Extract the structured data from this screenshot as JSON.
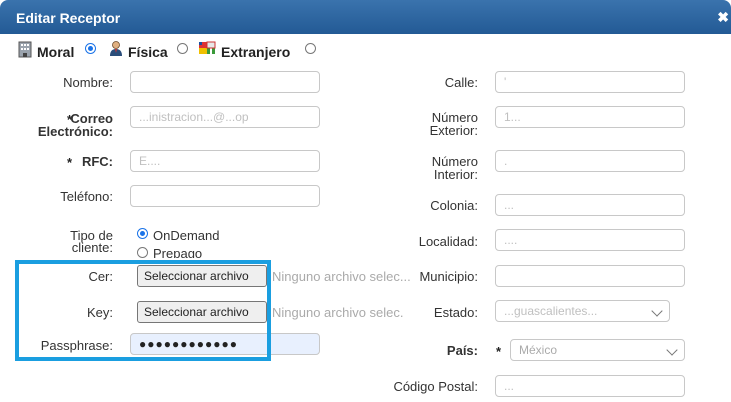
{
  "window": {
    "title": "Editar Receptor",
    "close_glyph": "✖"
  },
  "person_type": {
    "options": [
      {
        "label": "Moral",
        "selected": true,
        "icon": "building-icon"
      },
      {
        "label": "Física",
        "selected": false,
        "icon": "person-icon"
      },
      {
        "label": "Extranjero",
        "selected": false,
        "icon": "flags-icon"
      }
    ]
  },
  "left": {
    "nombre": {
      "label": "Nombre:",
      "value": ""
    },
    "correo": {
      "label_star": "*",
      "label_line1": "Correo",
      "label_line2": "Electrónico:",
      "value": "...inistracion...@...op"
    },
    "rfc": {
      "label_star": "*",
      "label": "RFC:",
      "value": "E...."
    },
    "telefono": {
      "label": "Teléfono:",
      "value": ""
    },
    "tipo_cliente": {
      "label_line1": "Tipo de",
      "label_line2": "cliente:",
      "options": [
        {
          "label": "OnDemand",
          "selected": true
        },
        {
          "label": "Prepago",
          "selected": false
        }
      ]
    },
    "cer": {
      "label": "Cer:",
      "button": "Seleccionar archivo",
      "status": "Ninguno archivo selec..."
    },
    "key": {
      "label": "Key:",
      "button": "Seleccionar archivo",
      "status": "Ninguno archivo selec."
    },
    "passphrase": {
      "label": "Passphrase:",
      "value": "●●●●●●●●●●●●"
    }
  },
  "right": {
    "calle": {
      "label": "Calle:",
      "value": "'"
    },
    "numero_exterior": {
      "label_line1": "Número",
      "label_line2": "Exterior:",
      "value": "1..."
    },
    "numero_interior": {
      "label_line1": "Número",
      "label_line2": "Interior:",
      "value": "."
    },
    "colonia": {
      "label": "Colonia:",
      "value": "..."
    },
    "localidad": {
      "label": "Localidad:",
      "value": "...."
    },
    "municipio": {
      "label": "Municipio:",
      "value": ""
    },
    "estado": {
      "label": "Estado:",
      "value": "...guascalientes..."
    },
    "pais": {
      "label": "País:",
      "star": "*",
      "value": "México"
    },
    "codigo_postal": {
      "label": "Código Postal:",
      "value": "..."
    }
  },
  "colors": {
    "titlebar": "#2b6199",
    "highlight": "#1a9ee0",
    "radio_selected": "#1a73e8"
  }
}
